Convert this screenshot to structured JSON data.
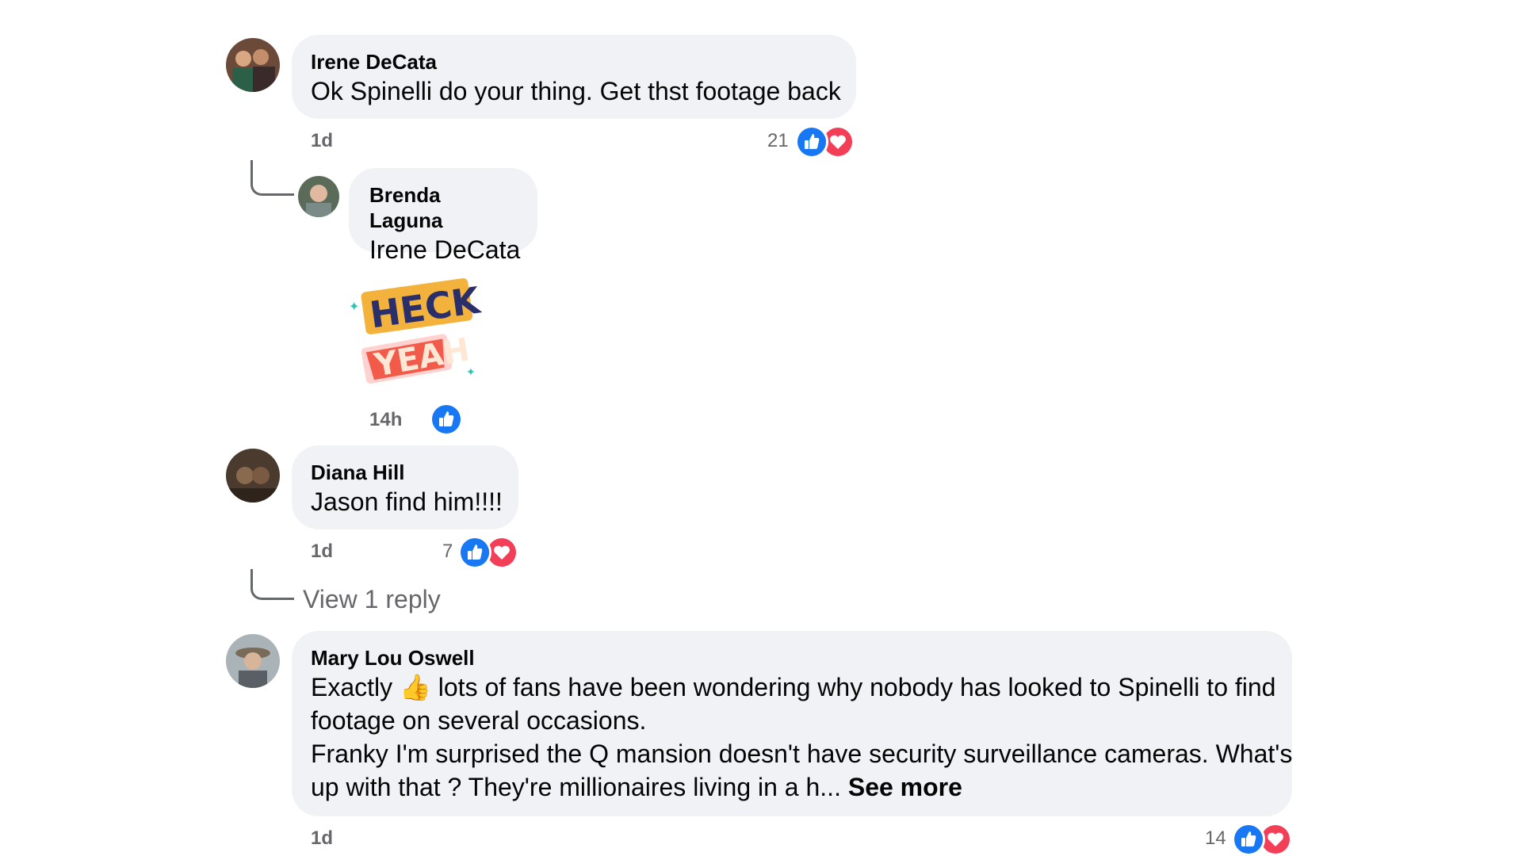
{
  "comments": [
    {
      "author": "Irene DeCata",
      "text": "Ok Spinelli do your thing. Get thst footage back",
      "time": "1d",
      "reaction_count": "21",
      "reactions": [
        "like-icon",
        "love-icon"
      ]
    },
    {
      "author": "Brenda Laguna",
      "text": "Irene DeCata",
      "sticker": "HECK YEAH",
      "time": "14h",
      "reactions": [
        "like-icon"
      ]
    },
    {
      "author": "Diana Hill",
      "text": "Jason find him!!!!",
      "time": "1d",
      "reaction_count": "7",
      "reactions": [
        "like-icon",
        "love-icon"
      ],
      "view_replies": "View 1 reply"
    },
    {
      "author": "Mary Lou Oswell",
      "text_line1_a": "Exactly",
      "emoji": "👍",
      "text_line1_b": "lots of fans have been wondering why nobody has looked to Spinelli to find",
      "text_line2": "footage on several occasions.",
      "text_line3": "Franky I'm surprised the Q mansion doesn't have security surveillance cameras. What's",
      "text_line4": "up with that ? They're millionaires living in a h...",
      "see_more": "See more",
      "time": "1d",
      "reaction_count": "14",
      "reactions": [
        "like-icon",
        "love-icon"
      ]
    }
  ],
  "colors": {
    "bubble": "#f0f2f5",
    "like": "#1877f2",
    "love": "#f33e58",
    "meta": "#65676b"
  }
}
